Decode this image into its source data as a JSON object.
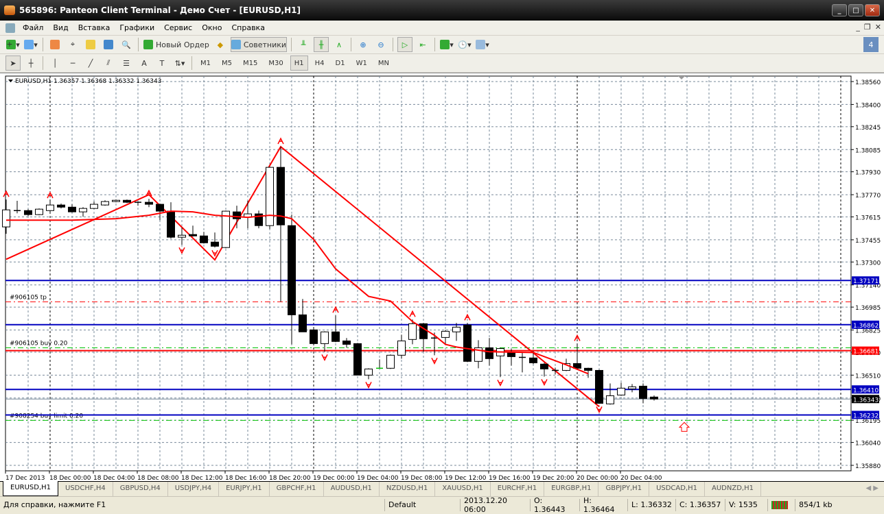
{
  "window": {
    "title": "565896: Panteon Client Terminal - Демо Счет - [EURUSD,H1]"
  },
  "menu": [
    "Файл",
    "Вид",
    "Вставка",
    "Графики",
    "Сервис",
    "Окно",
    "Справка"
  ],
  "toolbar": {
    "new_order": "Новый Ордер",
    "experts": "Советники"
  },
  "timeframes": [
    "M1",
    "M5",
    "M15",
    "M30",
    "H1",
    "H4",
    "D1",
    "W1",
    "MN"
  ],
  "active_timeframe": "H1",
  "chart_data": {
    "type": "candlestick",
    "title": "EURUSD,H1  1.36357 1.36368 1.36332 1.36343",
    "ylim": [
      1.3588,
      1.3856
    ],
    "yticks": [
      "1.38560",
      "1.38400",
      "1.38245",
      "1.38085",
      "1.37930",
      "1.37770",
      "1.37615",
      "1.37455",
      "1.37300",
      "1.37140",
      "1.36985",
      "1.36825",
      "1.36670",
      "1.36510",
      "1.36350",
      "1.36195",
      "1.36040",
      "1.35880"
    ],
    "xticks": [
      "17 Dec 2013",
      "18 Dec 00:00",
      "18 Dec 04:00",
      "18 Dec 08:00",
      "18 Dec 12:00",
      "18 Dec 16:00",
      "18 Dec 20:00",
      "19 Dec 00:00",
      "19 Dec 04:00",
      "19 Dec 08:00",
      "19 Dec 12:00",
      "19 Dec 16:00",
      "19 Dec 20:00",
      "20 Dec 00:00",
      "20 Dec 04:00"
    ],
    "ohlc": [
      [
        1.37545,
        1.37736,
        1.37497,
        1.37664
      ],
      [
        1.37659,
        1.37727,
        1.3764,
        1.37659
      ],
      [
        1.37659,
        1.37669,
        1.37621,
        1.37631
      ],
      [
        1.37631,
        1.37674,
        1.37626,
        1.37669
      ],
      [
        1.37659,
        1.37727,
        1.3764,
        1.37698
      ],
      [
        1.37698,
        1.37708,
        1.37674,
        1.37683
      ],
      [
        1.37683,
        1.37703,
        1.37645,
        1.3765
      ],
      [
        1.3765,
        1.37683,
        1.37616,
        1.37674
      ],
      [
        1.37674,
        1.37722,
        1.37669,
        1.37703
      ],
      [
        1.37698,
        1.37731,
        1.37693,
        1.37722
      ],
      [
        1.37722,
        1.37736,
        1.37717,
        1.37731
      ],
      [
        1.37731,
        1.37736,
        1.37712,
        1.37717
      ],
      [
        1.37717,
        1.37722,
        1.37693,
        1.37717
      ],
      [
        1.37717,
        1.37741,
        1.37683,
        1.37703
      ],
      [
        1.37703,
        1.37707,
        1.37592,
        1.37655
      ],
      [
        1.37655,
        1.37717,
        1.37463,
        1.37473
      ],
      [
        1.37473,
        1.3754,
        1.3742,
        1.37487
      ],
      [
        1.37492,
        1.37554,
        1.37477,
        1.37482
      ],
      [
        1.37482,
        1.37511,
        1.37429,
        1.37434
      ],
      [
        1.37439,
        1.37506,
        1.37401,
        1.3741
      ],
      [
        1.37401,
        1.37659,
        1.37396,
        1.37655
      ],
      [
        1.3765,
        1.37693,
        1.37535,
        1.37602
      ],
      [
        1.37612,
        1.37727,
        1.37535,
        1.37636
      ],
      [
        1.37636,
        1.37659,
        1.37535,
        1.37554
      ],
      [
        1.37554,
        1.37966,
        1.3753,
        1.37961
      ],
      [
        1.37961,
        1.38105,
        1.37022,
        1.37559
      ],
      [
        1.37554,
        1.37631,
        1.36725,
        1.36931
      ],
      [
        1.36931,
        1.37042,
        1.36812,
        1.36812
      ],
      [
        1.36826,
        1.36836,
        1.36725,
        1.3673
      ],
      [
        1.3673,
        1.36816,
        1.36673,
        1.36812
      ],
      [
        1.36812,
        1.36927,
        1.3674,
        1.36745
      ],
      [
        1.36749,
        1.36769,
        1.36701,
        1.36725
      ],
      [
        1.3673,
        1.36735,
        1.3651,
        1.3651
      ],
      [
        1.3651,
        1.36558,
        1.36481,
        1.36553
      ],
      [
        1.36558,
        1.3662,
        1.36558,
        1.36558
      ],
      [
        1.36558,
        1.36654,
        1.36553,
        1.36649
      ],
      [
        1.36649,
        1.36792,
        1.36625,
        1.36749
      ],
      [
        1.36759,
        1.36898,
        1.36725,
        1.36869
      ],
      [
        1.36869,
        1.36874,
        1.36673,
        1.36764
      ],
      [
        1.36769,
        1.36807,
        1.36649,
        1.36769
      ],
      [
        1.36773,
        1.36826,
        1.36721,
        1.36816
      ],
      [
        1.36812,
        1.36874,
        1.36749,
        1.36845
      ],
      [
        1.3686,
        1.36874,
        1.36601,
        1.36606
      ],
      [
        1.36606,
        1.36754,
        1.36558,
        1.36701
      ],
      [
        1.36701,
        1.36769,
        1.36577,
        1.36625
      ],
      [
        1.36644,
        1.36701,
        1.36496,
        1.36696
      ],
      [
        1.36668,
        1.36692,
        1.36577,
        1.36639
      ],
      [
        1.36634,
        1.36673,
        1.36529,
        1.3663
      ],
      [
        1.3663,
        1.36678,
        1.36587,
        1.36596
      ],
      [
        1.36587,
        1.36596,
        1.365,
        1.36553
      ],
      [
        1.36543,
        1.36562,
        1.36515,
        1.36543
      ],
      [
        1.36543,
        1.36625,
        1.36538,
        1.36591
      ],
      [
        1.36591,
        1.3673,
        1.36553,
        1.36558
      ],
      [
        1.36558,
        1.36562,
        1.36491,
        1.36543
      ],
      [
        1.36543,
        1.36548,
        1.36309,
        1.36313
      ],
      [
        1.36309,
        1.36452,
        1.36304,
        1.36366
      ],
      [
        1.36371,
        1.36457,
        1.36366,
        1.36419
      ],
      [
        1.36414,
        1.36448,
        1.3639,
        1.36428
      ],
      [
        1.36433,
        1.36452,
        1.36313,
        1.36347
      ],
      [
        1.36357,
        1.36368,
        1.36332,
        1.36343
      ]
    ],
    "moving_average": [
      [
        0,
        1.37592
      ],
      [
        6,
        1.37592
      ],
      [
        10,
        1.37602
      ],
      [
        13,
        1.37626
      ],
      [
        15,
        1.37655
      ],
      [
        17,
        1.3765
      ],
      [
        19,
        1.37626
      ],
      [
        22,
        1.37612
      ],
      [
        24,
        1.37626
      ],
      [
        25,
        1.37621
      ],
      [
        26,
        1.37602
      ],
      [
        28,
        1.37458
      ],
      [
        30,
        1.37252
      ],
      [
        33,
        1.3706
      ],
      [
        35,
        1.37027
      ],
      [
        37,
        1.36884
      ],
      [
        39,
        1.36788
      ],
      [
        40,
        1.36725
      ],
      [
        41,
        1.36706
      ],
      [
        44,
        1.36673
      ],
      [
        48,
        1.36668
      ],
      [
        51,
        1.36582
      ],
      [
        53,
        1.3652
      ]
    ],
    "zigzag": [
      [
        0,
        1.37319
      ],
      [
        13,
        1.3777
      ],
      [
        19,
        1.37315
      ],
      [
        25,
        1.38105
      ],
      [
        54,
        1.3629
      ]
    ],
    "fractals_up": [
      0,
      4,
      13,
      25,
      30,
      37,
      42,
      52
    ],
    "fractals_down": [
      16,
      19,
      29,
      33,
      39,
      45,
      49,
      54
    ],
    "levels": [
      {
        "price": 1.37171,
        "color": "#0000c0",
        "style": "solid",
        "label": "1.37171"
      },
      {
        "price": 1.36862,
        "color": "#0000c0",
        "style": "solid",
        "label": "1.36862"
      },
      {
        "price": 1.36681,
        "color": "#ff0000",
        "style": "solid",
        "label": "1.36681"
      },
      {
        "price": 1.3641,
        "color": "#0000c0",
        "style": "solid",
        "label": "1.36410"
      },
      {
        "price": 1.36232,
        "color": "#0000c0",
        "style": "solid",
        "label": "1.36232"
      }
    ],
    "orders": [
      {
        "price": 1.37022,
        "color": "#ff0000",
        "text": "#906105 tp"
      },
      {
        "price": 1.36701,
        "color": "#00c000",
        "text": "#906105 buy 0.20"
      },
      {
        "price": 1.36194,
        "color": "#00c000",
        "text": "#908254 buy limit 0.20"
      }
    ],
    "current_price": "1.36343",
    "colors": {
      "up": "#ffffff",
      "down": "#000000",
      "indicator": "#ff0000",
      "grid": "#778899"
    }
  },
  "tabs": [
    "EURUSD,H1",
    "USDCHF,H4",
    "GBPUSD,H4",
    "USDJPY,H4",
    "EURJPY,H1",
    "GBPCHF,H1",
    "AUDUSD,H1",
    "NZDUSD,H1",
    "XAUUSD,H1",
    "EURCHF,H1",
    "EURGBP,H1",
    "GBPJPY,H1",
    "USDCAD,H1",
    "AUDNZD,H1"
  ],
  "status": {
    "help": "Для справки, нажмите F1",
    "profile": "Default",
    "time": "2013.12.20 06:00",
    "open": "O: 1.36443",
    "high": "H: 1.36464",
    "low": "L: 1.36332",
    "close": "C: 1.36357",
    "volume": "V: 1535",
    "traffic": "854/1 kb"
  }
}
